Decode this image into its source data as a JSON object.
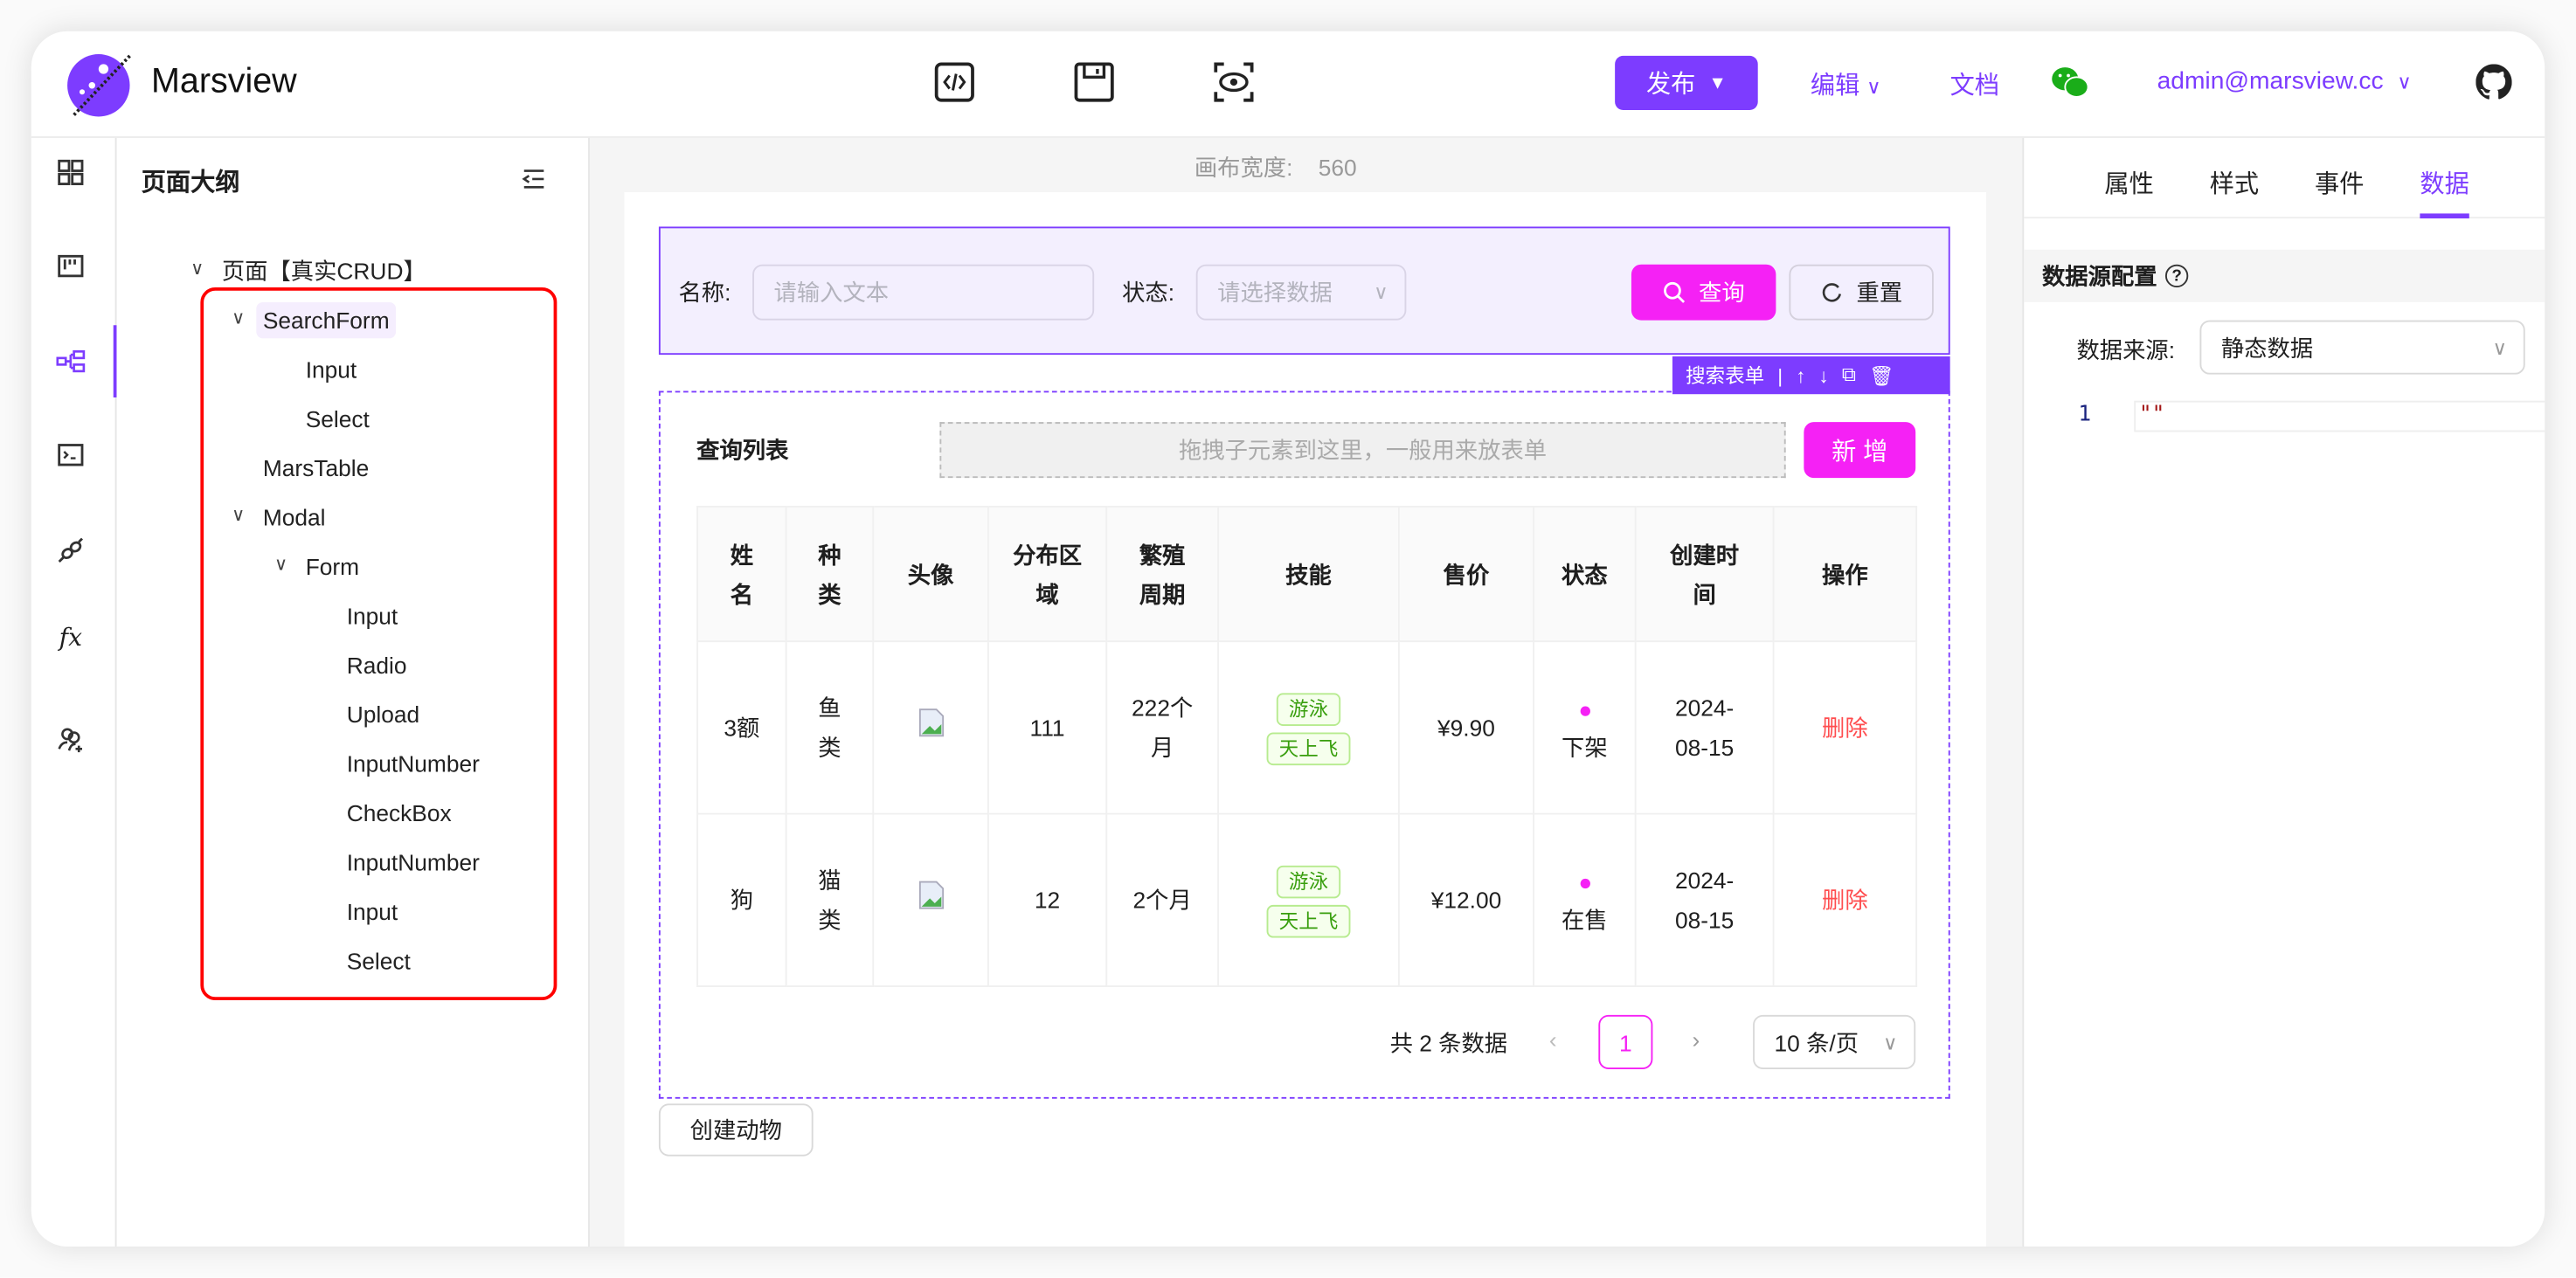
{
  "app": {
    "name": "Marsview"
  },
  "header": {
    "tools": [
      "code-icon",
      "save-icon",
      "preview-icon"
    ],
    "publish_label": "发布",
    "edit_label": "编辑",
    "docs_label": "文档",
    "user_email": "admin@marsview.cc",
    "accent": "#7d3cff"
  },
  "sidebar": {
    "icons": [
      "components-icon",
      "templates-icon",
      "outline-icon",
      "code-icon",
      "api-plugin-icon",
      "function-icon",
      "members-icon"
    ],
    "active": 2
  },
  "outline": {
    "title": "页面大纲",
    "root": "页面【真实CRUD】",
    "items": [
      "SearchForm",
      "Input",
      "Select",
      "MarsTable",
      "Modal",
      "Form",
      "Input",
      "Radio",
      "Upload",
      "InputNumber",
      "CheckBox",
      "InputNumber",
      "Input",
      "Select"
    ]
  },
  "canvas": {
    "width_label": "画布宽度:",
    "width_value": "560",
    "search_form": {
      "name_label": "名称:",
      "name_placeholder": "请输入文本",
      "status_label": "状态:",
      "status_placeholder": "请选择数据",
      "query_label": "查询",
      "reset_label": "重置",
      "toolbar_label": "搜索表单"
    },
    "table_section": {
      "title": "查询列表",
      "dropzone": "拖拽子元素到这里，一般用来放表单",
      "add_label": "新 增",
      "columns": [
        "姓名",
        "种类",
        "头像",
        "分布区域",
        "繁殖周期",
        "技能",
        "售价",
        "状态",
        "创建时间",
        "操作"
      ],
      "rows": [
        {
          "name": "3额",
          "type": "鱼类",
          "region": "111",
          "cycle": "222个月",
          "skills": [
            "游泳",
            "天上飞"
          ],
          "price": "¥9.90",
          "status": "下架",
          "created": "2024-08-15",
          "action": "删除"
        },
        {
          "name": "狗",
          "type": "猫类",
          "region": "12",
          "cycle": "2个月",
          "skills": [
            "游泳",
            "天上飞"
          ],
          "price": "¥12.00",
          "status": "在售",
          "created": "2024-08-15",
          "action": "删除"
        }
      ],
      "pagination": {
        "total": "共 2 条数据",
        "current": "1",
        "page_size": "10 条/页"
      }
    },
    "create_button": "创建动物",
    "magenta": "#f521f5"
  },
  "panel": {
    "tabs": [
      "属性",
      "样式",
      "事件",
      "数据"
    ],
    "active_tab": 3,
    "section_title": "数据源配置",
    "source_label": "数据来源:",
    "source_value": "静态数据",
    "code_line": "1",
    "code_value": "\"\""
  }
}
